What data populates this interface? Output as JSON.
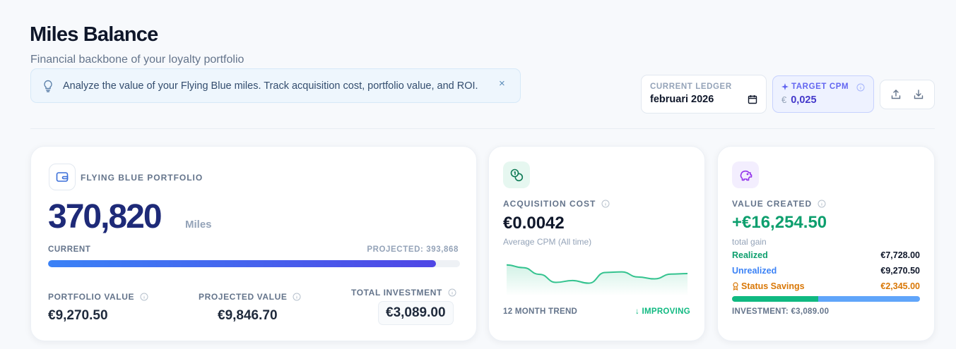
{
  "header": {
    "title": "Miles Balance",
    "subtitle": "Financial backbone of your loyalty portfolio"
  },
  "banner": {
    "message": "Analyze the value of your Flying Blue miles. Track acquisition cost, portfolio value, and ROI.",
    "icon": "lightbulb-icon",
    "close_label": "×"
  },
  "controls": {
    "ledger_label": "CURRENT LEDGER",
    "ledger_value": "februari 2026",
    "target_cpm_label": "TARGET CPM",
    "target_cpm_currency": "€",
    "target_cpm_value": "0,025"
  },
  "portfolio": {
    "label": "FLYING BLUE PORTFOLIO",
    "miles": "370,820",
    "unit": "Miles",
    "current_label": "CURRENT",
    "projected_label": "PROJECTED: 393,868",
    "progress_fraction": 0.942,
    "portfolio_value_label": "PORTFOLIO VALUE",
    "portfolio_value": "€9,270.50",
    "projected_value_label": "PROJECTED VALUE",
    "projected_value": "€9,846.70",
    "total_investment_label": "TOTAL INVESTMENT",
    "total_investment": "€3,089.00"
  },
  "acquisition": {
    "label": "ACQUISITION COST",
    "value": "€0.0042",
    "sub": "Average CPM (All time)",
    "trend_label": "12 MONTH TREND",
    "trend_status": "↓ IMPROVING",
    "trend_color": "#34c38f",
    "trend_points": [
      0.9,
      0.8,
      0.55,
      0.25,
      0.32,
      0.22,
      0.62,
      0.64,
      0.45,
      0.38,
      0.56,
      0.58
    ]
  },
  "value_created": {
    "label": "VALUE CREATED",
    "value": "+€16,254.50",
    "sub": "total gain",
    "realized_label": "Realized",
    "realized_value": "€7,728.00",
    "unrealized_label": "Unrealized",
    "unrealized_value": "€9,270.50",
    "status_savings_label": "Status Savings",
    "status_savings_value": "€2,345.00",
    "bar_split": [
      0.46,
      0.54
    ],
    "investment_label": "INVESTMENT: €3,089.00"
  },
  "colors": {
    "accent": "#4f46e5",
    "green": "#0e9f6e",
    "blue": "#3b82f6",
    "amber": "#d97706",
    "miles_navy": "#1e2a78"
  }
}
